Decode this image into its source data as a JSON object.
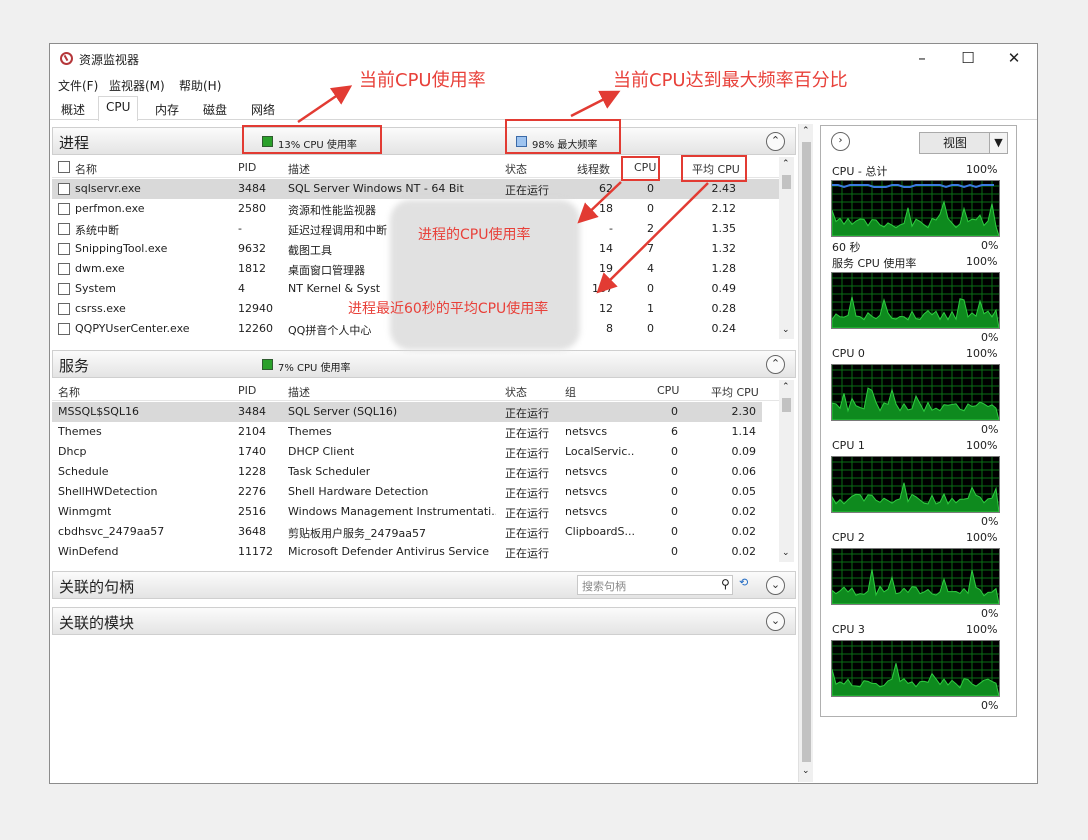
{
  "window": {
    "title": "资源监视器",
    "minimize": "–",
    "maximize": "☐",
    "close": "✕"
  },
  "menu": [
    "文件(F)",
    "监视器(M)",
    "帮助(H)"
  ],
  "tabs": [
    "概述",
    "CPU",
    "内存",
    "磁盘",
    "网络"
  ],
  "active_tab": "CPU",
  "processes": {
    "title": "进程",
    "cpu_usage": "13% CPU 使用率",
    "max_freq": "98% 最大频率",
    "columns": [
      "名称",
      "PID",
      "描述",
      "状态",
      "线程数",
      "CPU",
      "平均 CPU"
    ],
    "rows": [
      {
        "name": "sqlservr.exe",
        "pid": "3484",
        "desc": "SQL Server Windows NT - 64 Bit",
        "status": "正在运行",
        "threads": "62",
        "cpu": "0",
        "avg": "2.43"
      },
      {
        "name": "perfmon.exe",
        "pid": "2580",
        "desc": "资源和性能监视器",
        "status": "",
        "threads": "18",
        "cpu": "0",
        "avg": "2.12"
      },
      {
        "name": "系统中断",
        "pid": "-",
        "desc": "延迟过程调用和中断",
        "status": "",
        "threads": "-",
        "cpu": "2",
        "avg": "1.35"
      },
      {
        "name": "SnippingTool.exe",
        "pid": "9632",
        "desc": "截图工具",
        "status": "",
        "threads": "14",
        "cpu": "7",
        "avg": "1.32"
      },
      {
        "name": "dwm.exe",
        "pid": "1812",
        "desc": "桌面窗口管理器",
        "status": "",
        "threads": "19",
        "cpu": "4",
        "avg": "1.28"
      },
      {
        "name": "System",
        "pid": "4",
        "desc": "NT Kernel & Syst",
        "status": "",
        "threads": "167",
        "cpu": "0",
        "avg": "0.49"
      },
      {
        "name": "csrss.exe",
        "pid": "12940",
        "desc": "",
        "status": "",
        "threads": "12",
        "cpu": "1",
        "avg": "0.28"
      },
      {
        "name": "QQPYUserCenter.exe",
        "pid": "12260",
        "desc": "QQ拼音个人中心",
        "status": "",
        "threads": "8",
        "cpu": "0",
        "avg": "0.24"
      }
    ]
  },
  "services": {
    "title": "服务",
    "cpu_usage": "7% CPU 使用率",
    "columns": [
      "名称",
      "PID",
      "描述",
      "状态",
      "组",
      "CPU",
      "平均 CPU"
    ],
    "rows": [
      {
        "name": "MSSQL$SQL16",
        "pid": "3484",
        "desc": "SQL Server (SQL16)",
        "status": "正在运行",
        "group": "",
        "cpu": "0",
        "avg": "2.30"
      },
      {
        "name": "Themes",
        "pid": "2104",
        "desc": "Themes",
        "status": "正在运行",
        "group": "netsvcs",
        "cpu": "6",
        "avg": "1.14"
      },
      {
        "name": "Dhcp",
        "pid": "1740",
        "desc": "DHCP Client",
        "status": "正在运行",
        "group": "LocalServic...",
        "cpu": "0",
        "avg": "0.09"
      },
      {
        "name": "Schedule",
        "pid": "1228",
        "desc": "Task Scheduler",
        "status": "正在运行",
        "group": "netsvcs",
        "cpu": "0",
        "avg": "0.06"
      },
      {
        "name": "ShellHWDetection",
        "pid": "2276",
        "desc": "Shell Hardware Detection",
        "status": "正在运行",
        "group": "netsvcs",
        "cpu": "0",
        "avg": "0.05"
      },
      {
        "name": "Winmgmt",
        "pid": "2516",
        "desc": "Windows Management Instrumentati...",
        "status": "正在运行",
        "group": "netsvcs",
        "cpu": "0",
        "avg": "0.02"
      },
      {
        "name": "cbdhsvc_2479aa57",
        "pid": "3648",
        "desc": "剪贴板用户服务_2479aa57",
        "status": "正在运行",
        "group": "ClipboardS...",
        "cpu": "0",
        "avg": "0.02"
      },
      {
        "name": "WinDefend",
        "pid": "11172",
        "desc": "Microsoft Defender Antivirus Service",
        "status": "正在运行",
        "group": "",
        "cpu": "0",
        "avg": "0.02"
      }
    ]
  },
  "handles": {
    "title": "关联的句柄",
    "search_placeholder": "搜索句柄"
  },
  "modules": {
    "title": "关联的模块"
  },
  "graphs": {
    "view_label": "视图",
    "items": [
      {
        "label": "CPU - 总计",
        "max": "100%",
        "time": "60 秒",
        "min": "0%"
      },
      {
        "label": "服务 CPU 使用率",
        "max": "100%",
        "min": "0%"
      },
      {
        "label": "CPU 0",
        "max": "100%",
        "min": "0%"
      },
      {
        "label": "CPU 1",
        "max": "100%",
        "min": "0%"
      },
      {
        "label": "CPU 2",
        "max": "100%",
        "min": "0%"
      },
      {
        "label": "CPU 3",
        "max": "100%",
        "min": "0%"
      }
    ]
  },
  "annotations": {
    "current_cpu": "当前CPU使用率",
    "max_freq": "当前CPU达到最大频率百分比",
    "process_cpu": "进程的CPU使用率",
    "avg_cpu": "进程最近60秒的平均CPU使用率"
  },
  "colors": {
    "accent_red": "#e23b33",
    "graph_green": "#2ecc40",
    "graph_bg": "#000000"
  }
}
